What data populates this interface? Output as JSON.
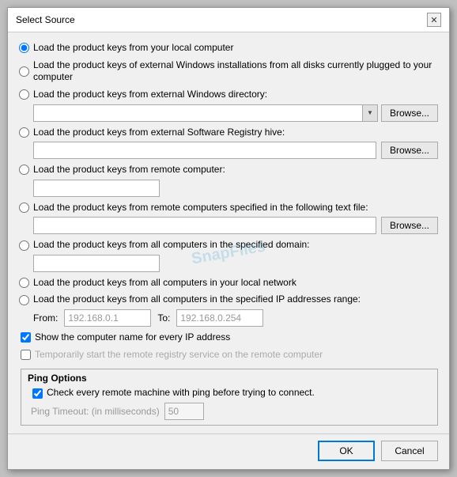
{
  "dialog": {
    "title": "Select Source",
    "close_label": "✕"
  },
  "options": {
    "radio1": "Load the product keys from your local computer",
    "radio2": "Load the product keys of external Windows installations from all disks currently plugged to your computer",
    "radio3": "Load the product keys from external Windows directory:",
    "radio4": "Load the product keys from external Software Registry hive:",
    "radio5": "Load the product keys from remote computer:",
    "radio6": "Load the product keys from remote computers specified in the following text file:",
    "radio7": "Load the product keys from all computers in the specified domain:",
    "radio8": "Load the product keys from all computers in your local network",
    "radio9": "Load the product keys from all computers in the specified IP addresses range:"
  },
  "inputs": {
    "dropdown_placeholder": "",
    "hive_placeholder": "",
    "remote_placeholder": "",
    "text_file_placeholder": "",
    "domain_placeholder": "",
    "from_label": "From:",
    "from_value": "192.168.0.1",
    "to_label": "To:",
    "to_value": "192.168.0.254"
  },
  "buttons": {
    "browse1": "Browse...",
    "browse2": "Browse...",
    "browse3": "Browse...",
    "ok": "OK",
    "cancel": "Cancel"
  },
  "checkboxes": {
    "show_computer_name": "Show the computer name for every IP address",
    "temp_start": "Temporarily start the remote registry service on the remote computer"
  },
  "ping": {
    "title": "Ping Options",
    "check_label": "Check every remote machine with ping before trying to connect.",
    "timeout_label": "Ping Timeout: (in milliseconds)",
    "timeout_value": "50"
  },
  "watermark": "SnapFiles"
}
